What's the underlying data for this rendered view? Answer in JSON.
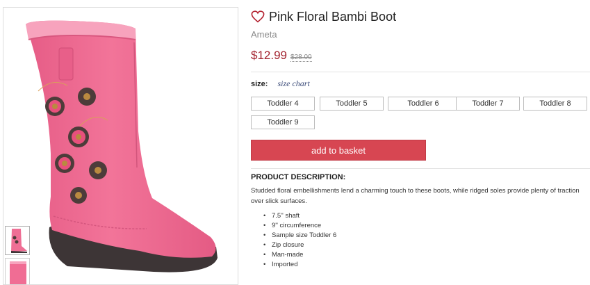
{
  "product": {
    "title": "Pink Floral Bambi Boot",
    "brand": "Ameta",
    "price": "$12.99",
    "original_price": "$28.00"
  },
  "size": {
    "label": "size:",
    "chart_link": "size chart",
    "options": [
      "Toddler 4",
      "Toddler 5",
      "Toddler 6",
      "Toddler 7",
      "Toddler 8",
      "Toddler 9"
    ]
  },
  "actions": {
    "add_to_basket": "add to basket"
  },
  "description": {
    "heading": "PRODUCT DESCRIPTION:",
    "text": "Studded floral embellishments lend a charming touch to these boots, while ridged soles provide plenty of traction over slick surfaces.",
    "features": [
      "7.5'' shaft",
      "9'' circumference",
      "Sample size Toddler 6",
      "Zip closure",
      "Man-made",
      "Imported"
    ]
  },
  "colors": {
    "accent": "#d74652",
    "price": "#a3232f",
    "boot": "#f06d94"
  },
  "icons": {
    "favorite": "heart-outline-icon"
  }
}
